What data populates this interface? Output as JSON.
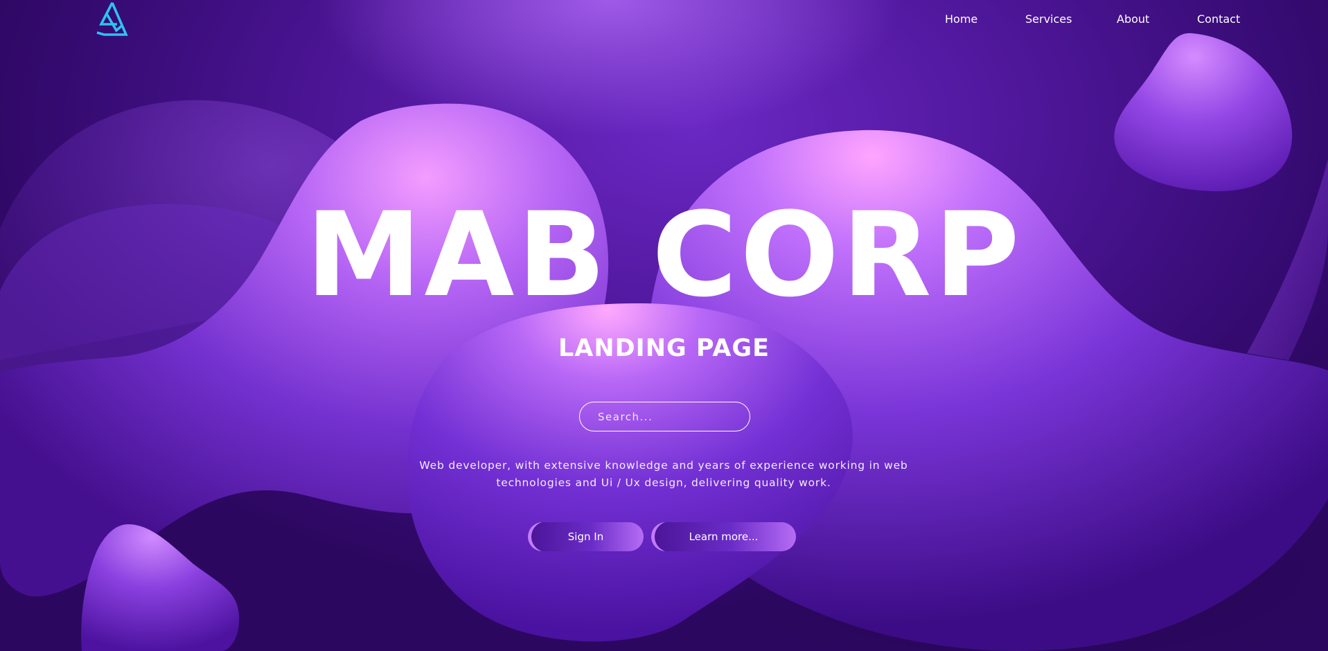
{
  "nav": {
    "logo_icon": "triangle-logo-icon",
    "links": [
      {
        "label": "Home"
      },
      {
        "label": "Services"
      },
      {
        "label": "About"
      },
      {
        "label": "Contact"
      }
    ]
  },
  "hero": {
    "title": "MAB CORP",
    "subtitle": "LANDING PAGE",
    "search": {
      "placeholder": "Search...",
      "value": ""
    },
    "description": "Web developer, with extensive knowledge and years of experience working in web technologies and Ui / Ux design, delivering quality work.",
    "buttons": {
      "sign_in": "Sign In",
      "learn_more": "Learn more..."
    }
  },
  "colors": {
    "background_dark": "#2c075f",
    "background_mid": "#4e1699",
    "blob_light": "#b66cf5",
    "blob_highlight": "#f3a6ff",
    "logo_accent": "#2cc3f2",
    "text": "#ffffff"
  }
}
